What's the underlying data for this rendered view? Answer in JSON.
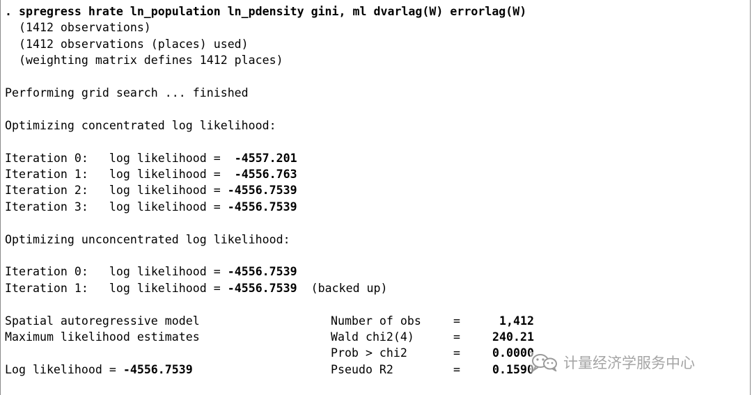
{
  "results": {
    "command": ". spregress hrate ln_population ln_pdensity gini, ml dvarlag(W) errorlag(W)",
    "obs_note": "(1412 observations)",
    "places_note": "(1412 observations (places) used)",
    "matrix_note": "(weighting matrix defines 1412 places)",
    "grid_search": "Performing grid search ... finished",
    "opt_concentrated": "Optimizing concentrated log likelihood:",
    "opt_unconcentrated": "Optimizing unconcentrated log likelihood:",
    "iterations_concentrated": [
      {
        "label": "Iteration 0:",
        "text": "log likelihood =",
        "value": " -4557.201"
      },
      {
        "label": "Iteration 1:",
        "text": "log likelihood =",
        "value": " -4556.763"
      },
      {
        "label": "Iteration 2:",
        "text": "log likelihood =",
        "value": "-4556.7539"
      },
      {
        "label": "Iteration 3:",
        "text": "log likelihood =",
        "value": "-4556.7539"
      }
    ],
    "iterations_unconcentrated": [
      {
        "label": "Iteration 0:",
        "text": "log likelihood =",
        "value": "-4556.7539",
        "note": ""
      },
      {
        "label": "Iteration 1:",
        "text": "log likelihood =",
        "value": "-4556.7539",
        "note": "(backed up)"
      }
    ],
    "model_title": "Spatial autoregressive model",
    "estimator": "Maximum likelihood estimates",
    "log_likelihood_label": "Log likelihood = ",
    "log_likelihood_value": "-4556.7539",
    "stats": [
      {
        "label": "Number of obs",
        "eq": "=",
        "value": "1,412"
      },
      {
        "label": "Wald chi2(4)",
        "eq": "=",
        "value": "240.21"
      },
      {
        "label": "Prob > chi2",
        "eq": "=",
        "value": "0.0000"
      },
      {
        "label": "Pseudo R2",
        "eq": "=",
        "value": "0.1590"
      }
    ]
  },
  "watermark": {
    "icon": "wechat-icon",
    "text": "计量经济学服务中心"
  }
}
